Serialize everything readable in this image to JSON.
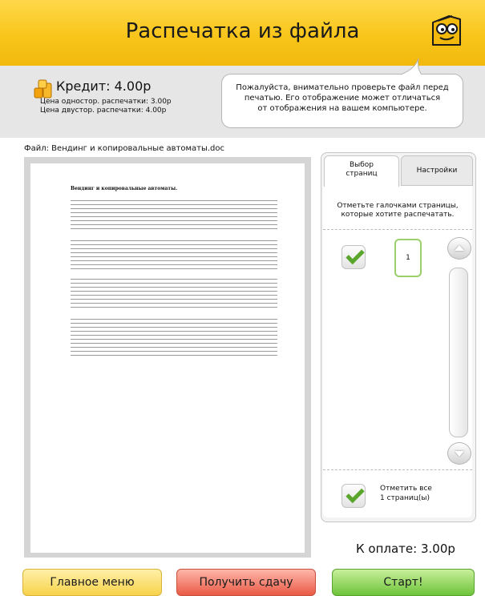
{
  "header": {
    "title": "Распечатка из файла"
  },
  "info": {
    "credit_label": "Кредит: 4.00р",
    "price_single": "Цена одностор. распечатки: 3.00р",
    "price_double": "Цена двустор. распечатки:   4.00р",
    "notice_line1": "Пожалуйста, внимательно проверьте файл перед",
    "notice_line2": "печатью. Его отображение может отличаться",
    "notice_line3": "от отображения на вашем компьютере."
  },
  "file": {
    "label": "Файл: Вендинг и копировальные автоматы.doc"
  },
  "document": {
    "title": "Вендинг и копировальные автоматы."
  },
  "panel": {
    "tab_pages_line1": "Выбор",
    "tab_pages_line2": "страниц",
    "tab_settings": "Настройки",
    "instruction_line1": "Отметьте галочками страницы,",
    "instruction_line2": "которые хотите распечатать.",
    "page_number": "1",
    "select_all_line1": "Отметить все",
    "select_all_line2": "1 страниц(ы)"
  },
  "total": {
    "label": "К оплате: 3.00р"
  },
  "buttons": {
    "main_menu": "Главное меню",
    "get_change": "Получить сдачу",
    "start": "Старт!"
  },
  "colors": {
    "header": "#f8c51a",
    "accent_green": "#5aa52c",
    "button_red": "#e95a45",
    "button_yellow": "#f7d24a"
  },
  "icons": [
    "mascot-icon",
    "coins-icon",
    "checkmark-icon",
    "scroll-up-icon",
    "scroll-down-icon"
  ]
}
